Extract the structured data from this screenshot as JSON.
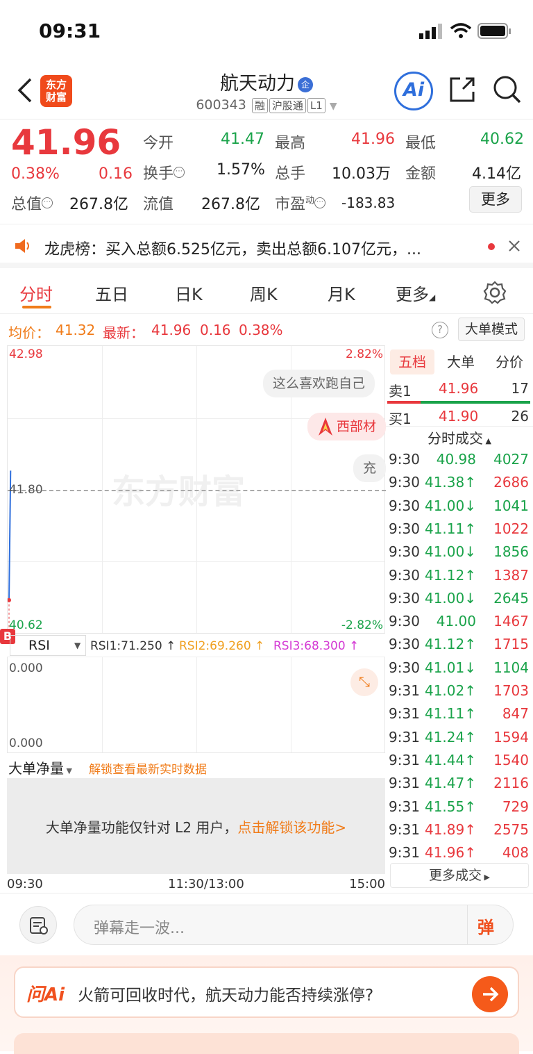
{
  "status": {
    "time": "09:31"
  },
  "header": {
    "logo_text": "东方财富",
    "stock_name": "航天动力",
    "qi_badge": "企",
    "code": "600343",
    "tags": [
      "融",
      "沪股通",
      "L1"
    ],
    "ai_label": "Ai"
  },
  "quote": {
    "price": "41.96",
    "change_pct": "0.38%",
    "change": "0.16",
    "open_label": "今开",
    "open": "41.47",
    "high_label": "最高",
    "high": "41.96",
    "low_label": "最低",
    "low": "40.62",
    "turnover_label": "换手",
    "turnover": "1.57%",
    "volume_label": "总手",
    "volume": "10.03万",
    "amount_label": "金额",
    "amount": "4.14亿",
    "mktcap_label": "总值",
    "mktcap": "267.8亿",
    "float_label": "流值",
    "float": "267.8亿",
    "pe_label": "市盈",
    "pe_sup": "动",
    "pe": "-183.83",
    "more": "更多"
  },
  "notice": {
    "text": "龙虎榜：买入总额6.525亿元，卖出总额6.107亿元，..."
  },
  "tabs": [
    "分时",
    "五日",
    "日K",
    "周K",
    "月K",
    "更多"
  ],
  "avg": {
    "avg_label": "均价：",
    "avg_value": "41.32",
    "latest_label": "最新：",
    "latest_value": "41.96",
    "latest_change": "0.16",
    "latest_pct": "0.38%",
    "big_mode": "大单模式"
  },
  "chart": {
    "top_price": "42.98",
    "top_pct": "2.82%",
    "mid_price": "41.80",
    "bottom_price": "40.62",
    "bottom_pct": "-2.82%",
    "watermark": "东方财富",
    "danmu": [
      "这么喜欢跑自己",
      "西部材",
      "充"
    ],
    "b_marker": "B"
  },
  "chart_data": {
    "type": "line",
    "x": [
      "09:30",
      "09:31"
    ],
    "series": [
      {
        "values": [
          40.9,
          41.96
        ]
      }
    ],
    "ylim": [
      40.62,
      42.98
    ],
    "reference": 41.8,
    "xticks": [
      "09:30",
      "11:30/13:00",
      "15:00"
    ]
  },
  "rsi": {
    "selector": "RSI",
    "rsi1": "RSI1:71.250 ↑",
    "rsi2": "RSI2:69.260 ↑",
    "rsi3": "RSI3:68.300 ↑",
    "top": "0.000",
    "bottom": "0.000"
  },
  "net": {
    "selector": "大单净量",
    "unlock": "解锁查看最新实时数据",
    "msg_a": "大单净量功能仅针对 L2 用户，",
    "msg_b": "点击解锁该功能>"
  },
  "axis": {
    "start": "09:30",
    "mid": "11:30/13:00",
    "end": "15:00"
  },
  "side": {
    "tabs": [
      "五档",
      "大单",
      "分价"
    ],
    "sell1": {
      "label": "卖1",
      "price": "41.96",
      "vol": "17"
    },
    "buy1": {
      "label": "买1",
      "price": "41.90",
      "vol": "26"
    },
    "trade_header": "分时成交",
    "trades": [
      {
        "t": "9:30",
        "p": "40.98",
        "v": "4027",
        "pc": "green",
        "vc": "green"
      },
      {
        "t": "9:30",
        "p": "41.38↑",
        "v": "2686",
        "pc": "green",
        "vc": "red"
      },
      {
        "t": "9:30",
        "p": "41.00↓",
        "v": "1041",
        "pc": "green",
        "vc": "green"
      },
      {
        "t": "9:30",
        "p": "41.11↑",
        "v": "1022",
        "pc": "green",
        "vc": "red"
      },
      {
        "t": "9:30",
        "p": "41.00↓",
        "v": "1856",
        "pc": "green",
        "vc": "green"
      },
      {
        "t": "9:30",
        "p": "41.12↑",
        "v": "1387",
        "pc": "green",
        "vc": "red"
      },
      {
        "t": "9:30",
        "p": "41.00↓",
        "v": "2645",
        "pc": "green",
        "vc": "green"
      },
      {
        "t": "9:30",
        "p": "41.00",
        "v": "1467",
        "pc": "green",
        "vc": "red"
      },
      {
        "t": "9:30",
        "p": "41.12↑",
        "v": "1715",
        "pc": "green",
        "vc": "red"
      },
      {
        "t": "9:30",
        "p": "41.01↓",
        "v": "1104",
        "pc": "green",
        "vc": "green"
      },
      {
        "t": "9:31",
        "p": "41.02↑",
        "v": "1703",
        "pc": "green",
        "vc": "red"
      },
      {
        "t": "9:31",
        "p": "41.11↑",
        "v": "847",
        "pc": "green",
        "vc": "red"
      },
      {
        "t": "9:31",
        "p": "41.24↑",
        "v": "1594",
        "pc": "green",
        "vc": "red"
      },
      {
        "t": "9:31",
        "p": "41.44↑",
        "v": "1540",
        "pc": "green",
        "vc": "red"
      },
      {
        "t": "9:31",
        "p": "41.47↑",
        "v": "2116",
        "pc": "green",
        "vc": "red"
      },
      {
        "t": "9:31",
        "p": "41.55↑",
        "v": "729",
        "pc": "green",
        "vc": "red"
      },
      {
        "t": "9:31",
        "p": "41.89↑",
        "v": "2575",
        "pc": "red",
        "vc": "red"
      },
      {
        "t": "9:31",
        "p": "41.96↑",
        "v": "408",
        "pc": "red",
        "vc": "red"
      }
    ],
    "more_trades": "更多成交"
  },
  "danmu": {
    "placeholder": "弹幕走一波...",
    "send": "弹"
  },
  "ai": {
    "label": "问Ai",
    "question": "火箭可回收时代，航天动力能否持续涨停?"
  },
  "colors": {
    "red": "#e8383d",
    "green": "#1aa34a",
    "orange": "#f07c1a",
    "blue": "#2f6fdc"
  }
}
